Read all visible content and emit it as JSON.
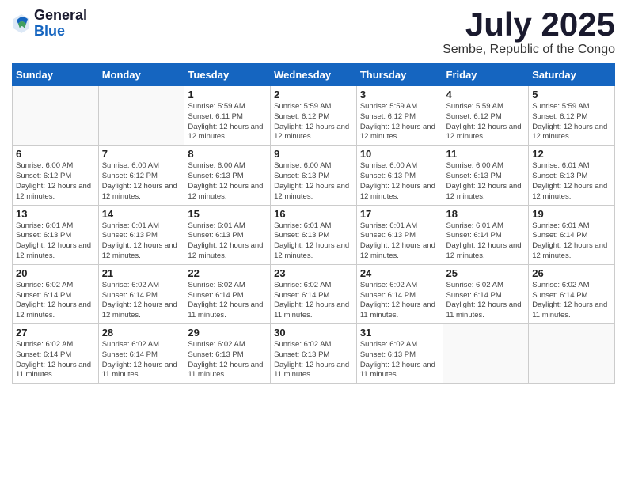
{
  "logo": {
    "general": "General",
    "blue": "Blue"
  },
  "title": "July 2025",
  "subtitle": "Sembe, Republic of the Congo",
  "days_of_week": [
    "Sunday",
    "Monday",
    "Tuesday",
    "Wednesday",
    "Thursday",
    "Friday",
    "Saturday"
  ],
  "weeks": [
    [
      {
        "day": "",
        "info": ""
      },
      {
        "day": "",
        "info": ""
      },
      {
        "day": "1",
        "info": "Sunrise: 5:59 AM\nSunset: 6:11 PM\nDaylight: 12 hours and 12 minutes."
      },
      {
        "day": "2",
        "info": "Sunrise: 5:59 AM\nSunset: 6:12 PM\nDaylight: 12 hours and 12 minutes."
      },
      {
        "day": "3",
        "info": "Sunrise: 5:59 AM\nSunset: 6:12 PM\nDaylight: 12 hours and 12 minutes."
      },
      {
        "day": "4",
        "info": "Sunrise: 5:59 AM\nSunset: 6:12 PM\nDaylight: 12 hours and 12 minutes."
      },
      {
        "day": "5",
        "info": "Sunrise: 5:59 AM\nSunset: 6:12 PM\nDaylight: 12 hours and 12 minutes."
      }
    ],
    [
      {
        "day": "6",
        "info": "Sunrise: 6:00 AM\nSunset: 6:12 PM\nDaylight: 12 hours and 12 minutes."
      },
      {
        "day": "7",
        "info": "Sunrise: 6:00 AM\nSunset: 6:12 PM\nDaylight: 12 hours and 12 minutes."
      },
      {
        "day": "8",
        "info": "Sunrise: 6:00 AM\nSunset: 6:13 PM\nDaylight: 12 hours and 12 minutes."
      },
      {
        "day": "9",
        "info": "Sunrise: 6:00 AM\nSunset: 6:13 PM\nDaylight: 12 hours and 12 minutes."
      },
      {
        "day": "10",
        "info": "Sunrise: 6:00 AM\nSunset: 6:13 PM\nDaylight: 12 hours and 12 minutes."
      },
      {
        "day": "11",
        "info": "Sunrise: 6:00 AM\nSunset: 6:13 PM\nDaylight: 12 hours and 12 minutes."
      },
      {
        "day": "12",
        "info": "Sunrise: 6:01 AM\nSunset: 6:13 PM\nDaylight: 12 hours and 12 minutes."
      }
    ],
    [
      {
        "day": "13",
        "info": "Sunrise: 6:01 AM\nSunset: 6:13 PM\nDaylight: 12 hours and 12 minutes."
      },
      {
        "day": "14",
        "info": "Sunrise: 6:01 AM\nSunset: 6:13 PM\nDaylight: 12 hours and 12 minutes."
      },
      {
        "day": "15",
        "info": "Sunrise: 6:01 AM\nSunset: 6:13 PM\nDaylight: 12 hours and 12 minutes."
      },
      {
        "day": "16",
        "info": "Sunrise: 6:01 AM\nSunset: 6:13 PM\nDaylight: 12 hours and 12 minutes."
      },
      {
        "day": "17",
        "info": "Sunrise: 6:01 AM\nSunset: 6:13 PM\nDaylight: 12 hours and 12 minutes."
      },
      {
        "day": "18",
        "info": "Sunrise: 6:01 AM\nSunset: 6:14 PM\nDaylight: 12 hours and 12 minutes."
      },
      {
        "day": "19",
        "info": "Sunrise: 6:01 AM\nSunset: 6:14 PM\nDaylight: 12 hours and 12 minutes."
      }
    ],
    [
      {
        "day": "20",
        "info": "Sunrise: 6:02 AM\nSunset: 6:14 PM\nDaylight: 12 hours and 12 minutes."
      },
      {
        "day": "21",
        "info": "Sunrise: 6:02 AM\nSunset: 6:14 PM\nDaylight: 12 hours and 12 minutes."
      },
      {
        "day": "22",
        "info": "Sunrise: 6:02 AM\nSunset: 6:14 PM\nDaylight: 12 hours and 11 minutes."
      },
      {
        "day": "23",
        "info": "Sunrise: 6:02 AM\nSunset: 6:14 PM\nDaylight: 12 hours and 11 minutes."
      },
      {
        "day": "24",
        "info": "Sunrise: 6:02 AM\nSunset: 6:14 PM\nDaylight: 12 hours and 11 minutes."
      },
      {
        "day": "25",
        "info": "Sunrise: 6:02 AM\nSunset: 6:14 PM\nDaylight: 12 hours and 11 minutes."
      },
      {
        "day": "26",
        "info": "Sunrise: 6:02 AM\nSunset: 6:14 PM\nDaylight: 12 hours and 11 minutes."
      }
    ],
    [
      {
        "day": "27",
        "info": "Sunrise: 6:02 AM\nSunset: 6:14 PM\nDaylight: 12 hours and 11 minutes."
      },
      {
        "day": "28",
        "info": "Sunrise: 6:02 AM\nSunset: 6:14 PM\nDaylight: 12 hours and 11 minutes."
      },
      {
        "day": "29",
        "info": "Sunrise: 6:02 AM\nSunset: 6:13 PM\nDaylight: 12 hours and 11 minutes."
      },
      {
        "day": "30",
        "info": "Sunrise: 6:02 AM\nSunset: 6:13 PM\nDaylight: 12 hours and 11 minutes."
      },
      {
        "day": "31",
        "info": "Sunrise: 6:02 AM\nSunset: 6:13 PM\nDaylight: 12 hours and 11 minutes."
      },
      {
        "day": "",
        "info": ""
      },
      {
        "day": "",
        "info": ""
      }
    ]
  ]
}
